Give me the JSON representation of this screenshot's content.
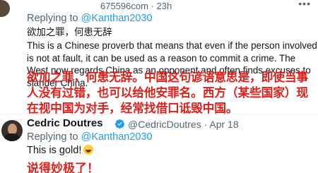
{
  "tweet1": {
    "meta": "675596com · 23h",
    "more_label": "•••",
    "replying_prefix": "Replying to ",
    "replying_handle": "@Kanthan2030",
    "line1": "欲加之罪，何患无辞",
    "line2": "This is a Chinese proverb that means that even if the person involved is not at fault, it can be used as a reason to commit a crime. The West now regards China as an opponent and often finds excuses to slander China.",
    "translation_overlay": "欲加之罪，何患无辞。中国这句谚语意思是，即使当事人没有过错，也可以给他安罪名。西方（某些国家）现在视中国为对手，经常找借口诋毁中国。"
  },
  "tweet2": {
    "name": "Cedric Doutres",
    "handle_date": "@CedricDoutres · Apr 18",
    "replying_prefix": "Replying to ",
    "replying_handle": "@Kanthan2030",
    "text": "This is gold!",
    "emoji": "rofl-emoji-icon",
    "translation_overlay": "说得妙极了！"
  },
  "colors": {
    "link": "#1d9bf0",
    "secondary_text": "#536471",
    "overlay_red": "#e0201a",
    "verified": "#1d9bf0"
  }
}
